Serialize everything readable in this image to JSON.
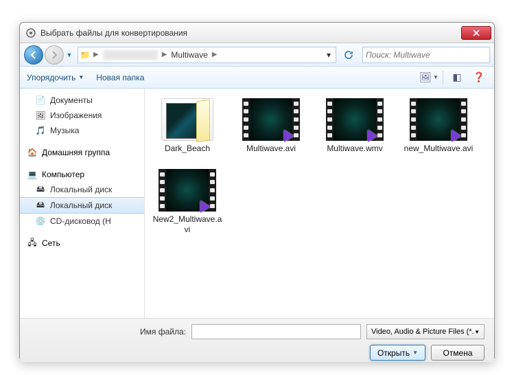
{
  "window": {
    "title": "Выбрать файлы для конвертирования"
  },
  "nav": {
    "crumb_current": "Multiwave",
    "search_placeholder": "Поиск: Multiwave"
  },
  "toolbar": {
    "organize": "Упорядочить",
    "new_folder": "Новая папка"
  },
  "sidebar": {
    "items": [
      {
        "kind": "item",
        "icon": "📄",
        "label": "Документы",
        "name": "sidebar-documents"
      },
      {
        "kind": "item",
        "icon": "🖼",
        "label": "Изображения",
        "name": "sidebar-pictures"
      },
      {
        "kind": "item",
        "icon": "🎵",
        "label": "Музыка",
        "name": "sidebar-music"
      },
      {
        "kind": "spacer"
      },
      {
        "kind": "group",
        "icon": "🏠",
        "label": "Домашняя группа",
        "name": "sidebar-homegroup"
      },
      {
        "kind": "spacer"
      },
      {
        "kind": "group",
        "icon": "💻",
        "label": "Компьютер",
        "name": "sidebar-computer"
      },
      {
        "kind": "item",
        "icon": "🖴",
        "label": "Локальный диск",
        "name": "sidebar-localdisk-1"
      },
      {
        "kind": "item",
        "icon": "🖴",
        "label": "Локальный диск",
        "name": "sidebar-localdisk-2",
        "selected": true
      },
      {
        "kind": "item",
        "icon": "💿",
        "label": "CD-дисковод (H",
        "name": "sidebar-cd-drive"
      },
      {
        "kind": "spacer"
      },
      {
        "kind": "group",
        "icon": "🖧",
        "label": "Сеть",
        "name": "sidebar-network"
      }
    ]
  },
  "files": [
    {
      "type": "folder",
      "label": "Dark_Beach",
      "name": "file-dark-beach"
    },
    {
      "type": "video",
      "label": "Multiwave.avi",
      "name": "file-multiwave-avi"
    },
    {
      "type": "video",
      "label": "Multiwave.wmv",
      "name": "file-multiwave-wmv"
    },
    {
      "type": "video",
      "label": "new_Multiwave.avi",
      "name": "file-new-multiwave-avi"
    },
    {
      "type": "video",
      "label": "New2_Multiwave.avi",
      "name": "file-new2-multiwave-avi"
    }
  ],
  "bottom": {
    "filename_label": "Имя файла:",
    "filter_label": "Video, Audio & Picture Files (*.",
    "open": "Открыть",
    "cancel": "Отмена"
  }
}
